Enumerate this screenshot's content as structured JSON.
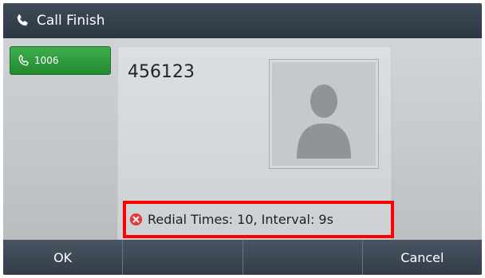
{
  "title_bar": {
    "icon": "phone-handset-icon",
    "title": "Call Finish"
  },
  "line_key": {
    "icon": "phone-handset-icon",
    "label": "1006",
    "color": "#2a9a3a"
  },
  "call": {
    "number": "456123",
    "avatar_icon": "contact-silhouette-icon"
  },
  "redial_status": {
    "icon": "error-x-icon",
    "text": "Redial Times: 10, Interval: 9s",
    "highlight_color": "#ff0000"
  },
  "softkeys": [
    {
      "label": "OK"
    },
    {
      "label": ""
    },
    {
      "label": ""
    },
    {
      "label": "Cancel"
    }
  ]
}
